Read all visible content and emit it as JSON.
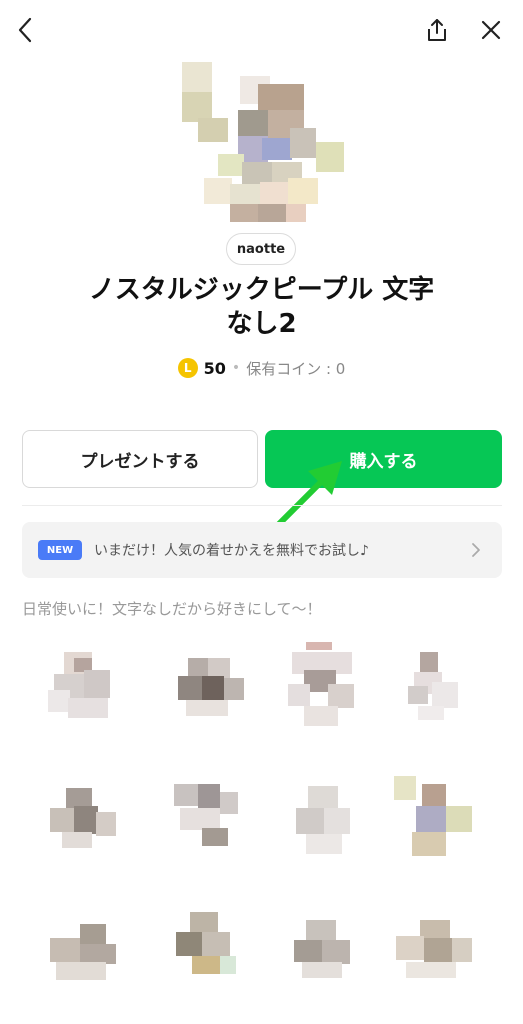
{
  "topbar": {
    "back_icon": "chevron-left-icon",
    "share_icon": "share-icon",
    "close_icon": "close-icon"
  },
  "author": "naotte",
  "title_line1": "ノスタルジックピープル 文字",
  "title_line2": "なし2",
  "price": {
    "coin_symbol": "L",
    "amount": "50",
    "separator": "•",
    "owned": "保有コイン : 0"
  },
  "actions": {
    "gift_label": "プレゼントする",
    "buy_label": "購入する"
  },
  "banner": {
    "badge": "NEW",
    "text": "いまだけ！人気の着せかえを無料でお試し♪"
  },
  "description": "日常使いに！文字なしだから好きにして〜！",
  "colors": {
    "line_green": "#06c755",
    "new_badge": "#4a7bf7",
    "annotation_arrow": "#22cc33",
    "coin": "#f5c400"
  }
}
